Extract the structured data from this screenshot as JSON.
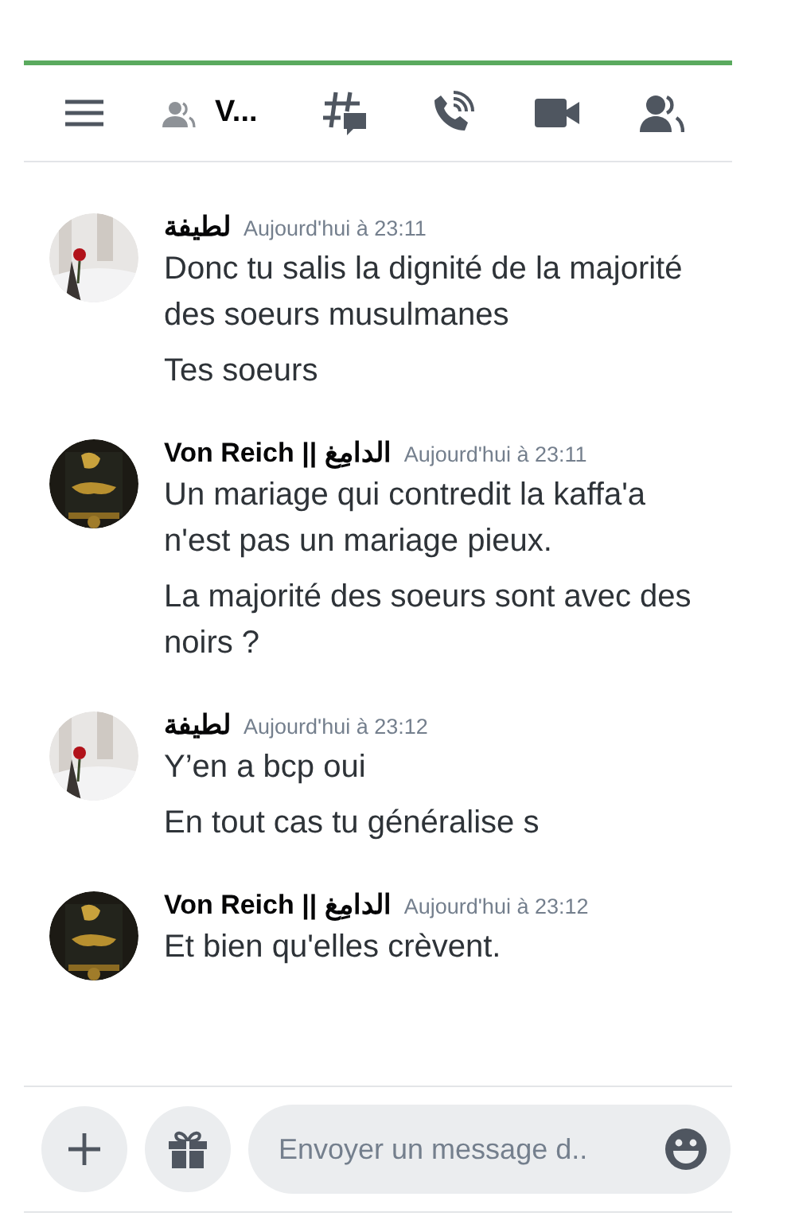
{
  "header": {
    "channel_name": "V..."
  },
  "messages": [
    {
      "author": "لطيفة",
      "time": "Aujourd'hui à 23:11",
      "lines": [
        "Donc tu salis la dignité de la majorité des soeurs musulmanes",
        "Tes soeurs"
      ]
    },
    {
      "author": "Von Reich || الدامِغ",
      "time": "Aujourd'hui à 23:11",
      "lines": [
        "Un mariage qui contredit la kaffa'a n'est pas un mariage pieux.",
        "La majorité des soeurs sont avec des noirs ?"
      ]
    },
    {
      "author": "لطيفة",
      "time": "Aujourd'hui à 23:12",
      "lines": [
        "Y’en a bcp oui",
        "En tout cas tu généralise s"
      ]
    },
    {
      "author": "Von Reich || الدامِغ",
      "time": "Aujourd'hui à 23:12",
      "lines": [
        "Et bien qu'elles crèvent."
      ]
    }
  ],
  "composer": {
    "placeholder": "Envoyer un message d.."
  }
}
